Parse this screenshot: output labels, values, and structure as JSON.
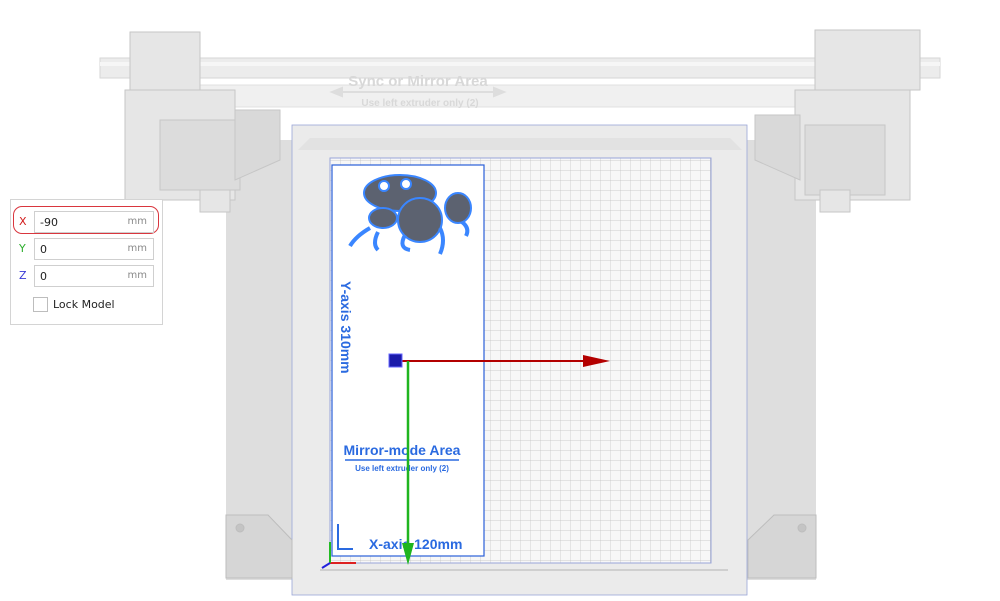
{
  "scene": {
    "top_banner_title": "Sync or Mirror Area",
    "top_banner_subtitle": "Use left extruder only (2)",
    "decal_title": "Mirror-mode Area",
    "decal_subtitle": "Use left extruder only (2)",
    "y_axis_label": "Y-axis 310mm",
    "x_axis_label": "X-axis 120mm",
    "gizmo_colors": {
      "x": "#b30000",
      "y": "#1fb51f",
      "handle": "#1a1aaa"
    }
  },
  "move_panel": {
    "x": {
      "label": "X",
      "value": "-90",
      "unit": "mm",
      "color": "#d21a1a"
    },
    "y": {
      "label": "Y",
      "value": "0",
      "unit": "mm",
      "color": "#2cae2c"
    },
    "z": {
      "label": "Z",
      "value": "0",
      "unit": "mm",
      "color": "#3a3ad6"
    },
    "lock_label": "Lock Model",
    "lock_checked": false
  }
}
